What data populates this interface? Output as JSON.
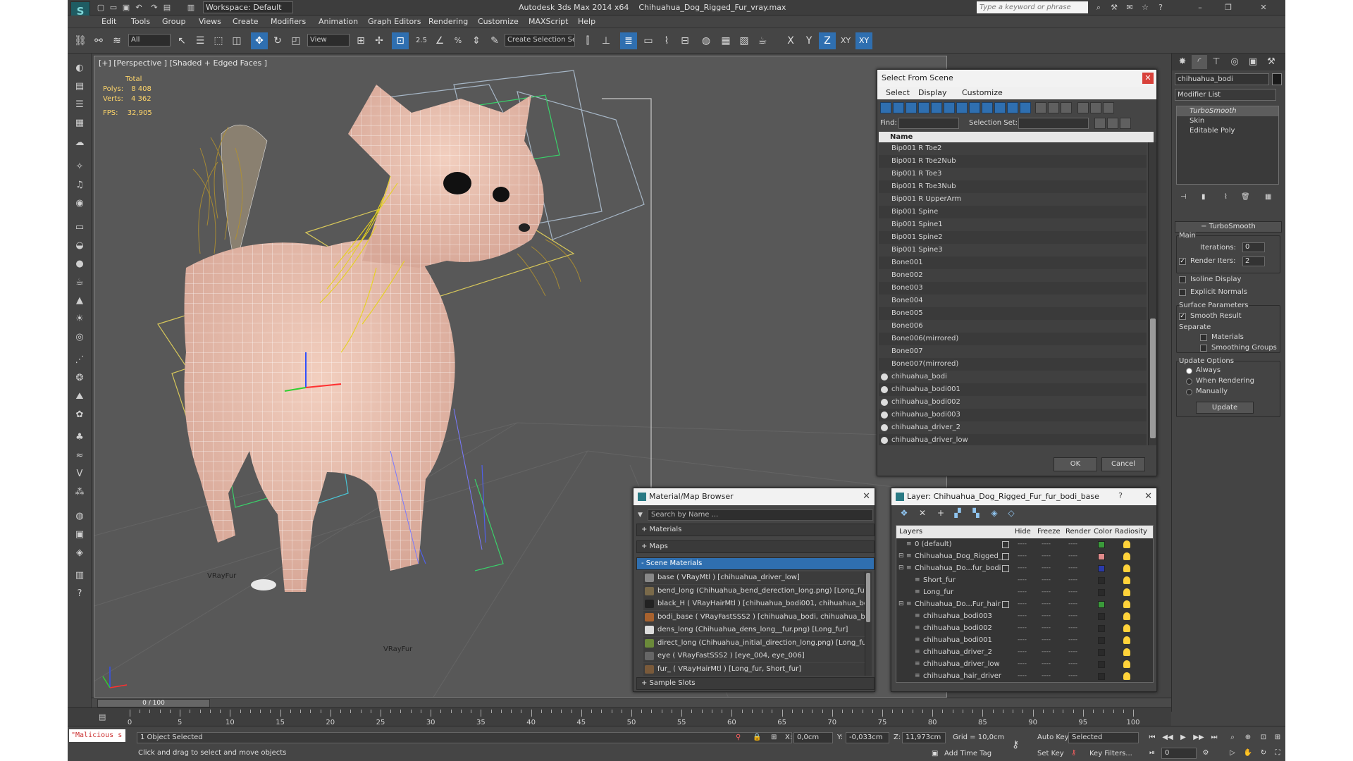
{
  "title": {
    "app": "Autodesk 3ds Max  2014 x64",
    "file": "Chihuahua_Dog_Rigged_Fur_vray.max",
    "workspace": "Workspace: Default",
    "search_placeholder": "Type a keyword or phrase"
  },
  "menu": [
    "Edit",
    "Tools",
    "Group",
    "Views",
    "Create",
    "Modifiers",
    "Animation",
    "Graph Editors",
    "Rendering",
    "Customize",
    "MAXScript",
    "Help"
  ],
  "toolbar": {
    "filter": "All",
    "ref_coord": "View",
    "snap_angle": "2.5",
    "selection_set": "Create Selection Se",
    "axis_x": "X",
    "axis_y": "Y",
    "axis_z": "Z",
    "axis_xy": "XY",
    "axis_xy2": "XY"
  },
  "viewport": {
    "label": "[+] [Perspective ] [Shaded + Edged Faces ]",
    "stats_total": "Total",
    "polys_label": "Polys:",
    "polys_value": "8 408",
    "verts_label": "Verts:",
    "verts_value": "4 362",
    "fps_label": "FPS:",
    "fps_value": "32,905",
    "vrayfur_1": "VRayFur",
    "vrayfur_2": "VRayFur"
  },
  "select_from_scene": {
    "title": "Select From Scene",
    "menu": [
      "Select",
      "Display",
      "Customize"
    ],
    "find_label": "Find:",
    "selection_set_label": "Selection Set:",
    "column_name": "Name",
    "rows": [
      "Bip001 R Toe2",
      "Bip001 R Toe2Nub",
      "Bip001 R Toe3",
      "Bip001 R Toe3Nub",
      "Bip001 R UpperArm",
      "Bip001 Spine",
      "Bip001 Spine1",
      "Bip001 Spine2",
      "Bip001 Spine3",
      "Bone001",
      "Bone002",
      "Bone003",
      "Bone004",
      "Bone005",
      "Bone006",
      "Bone006(mirrored)",
      "Bone007",
      "Bone007(mirrored)",
      "chihuahua_bodi",
      "chihuahua_bodi001",
      "chihuahua_bodi002",
      "chihuahua_bodi003",
      "chihuahua_driver_2",
      "chihuahua_driver_low"
    ],
    "ok": "OK",
    "cancel": "Cancel"
  },
  "material_browser": {
    "title": "Material/Map Browser",
    "search_placeholder": "Search by Name ...",
    "sections": [
      "+ Materials",
      "+ Maps",
      "- Scene Materials",
      "+ Sample Slots"
    ],
    "items": [
      {
        "label": "base  ( VRayMtl )  [chihuahua_driver_low]",
        "color": "#888888"
      },
      {
        "label": "bend_long (Chihuahua_bend_derection_long.png) [Long_fur]",
        "color": "#7a6a4a"
      },
      {
        "label": "black_H  ( VRayHairMtl )  [chihuahua_bodi001, chihuahua_bodi...",
        "color": "#222222"
      },
      {
        "label": "bodi_base  ( VRayFastSSS2 )  [chihuahua_bodi, chihuahua_bod...",
        "color": "#a8622e"
      },
      {
        "label": "dens_long (Chihuahua_dens_long__fur.png) [Long_fur]",
        "color": "#dddddd"
      },
      {
        "label": "direct_long (Chihuahua_initial_direction_long.png) [Long_fur]",
        "color": "#6b8a3a"
      },
      {
        "label": "eye  ( VRayFastSSS2 )  [eye_004, eye_006]",
        "color": "#666666"
      },
      {
        "label": "fur_  ( VRayHairMtl )  [Long_fur, Short_fur]",
        "color": "#7a5a3a"
      }
    ]
  },
  "layer_manager": {
    "title": "Layer: Chihuahua_Dog_Rigged_Fur_fur_bodi_base",
    "help": "?",
    "columns": [
      "Layers",
      "Hide",
      "Freeze",
      "Render",
      "Color",
      "Radiosity"
    ],
    "rows": [
      {
        "name": "0 (default)",
        "indent": 0,
        "color": "#3a9a3a"
      },
      {
        "name": "Chihuahua_Dog_Rigged_",
        "indent": 0,
        "color": "#e08a8a"
      },
      {
        "name": "Chihuahua_Do...fur_bodi",
        "indent": 0,
        "color": "#2a3aaa"
      },
      {
        "name": "Short_fur",
        "indent": 1,
        "color": "#2a2a2a"
      },
      {
        "name": "Long_fur",
        "indent": 1,
        "color": "#2a2a2a"
      },
      {
        "name": "Chihuahua_Do...Fur_hair",
        "indent": 0,
        "color": "#3a9a3a"
      },
      {
        "name": "chihuahua_bodi003",
        "indent": 1,
        "color": "#2a2a2a"
      },
      {
        "name": "chihuahua_bodi002",
        "indent": 1,
        "color": "#2a2a2a"
      },
      {
        "name": "chihuahua_bodi001",
        "indent": 1,
        "color": "#2a2a2a"
      },
      {
        "name": "chihuahua_driver_2",
        "indent": 1,
        "color": "#2a2a2a"
      },
      {
        "name": "chihuahua_driver_low",
        "indent": 1,
        "color": "#2a2a2a"
      },
      {
        "name": "chihuahua_hair_driver",
        "indent": 1,
        "color": "#2a2a2a"
      }
    ],
    "dash": "----"
  },
  "command_panel": {
    "object_name": "chihuahua_bodi",
    "modifier_list": "Modifier List",
    "stack": [
      "TurboSmooth",
      "Skin",
      "Editable Poly"
    ],
    "rollout_title": "TurboSmooth",
    "main_label": "Main",
    "iterations_label": "Iterations:",
    "iterations_value": "0",
    "render_iters_label": "Render Iters:",
    "render_iters_value": "2",
    "isoline_display": "Isoline Display",
    "explicit_normals": "Explicit Normals",
    "surface_parameters": "Surface Parameters",
    "smooth_result": "Smooth Result",
    "separate": "Separate",
    "materials": "Materials",
    "smoothing_groups": "Smoothing Groups",
    "update_options": "Update Options",
    "always": "Always",
    "when_rendering": "When Rendering",
    "manually": "Manually",
    "update_button": "Update"
  },
  "timeline": {
    "slider": "0 / 100",
    "ticks": [
      "0",
      "5",
      "10",
      "15",
      "20",
      "25",
      "30",
      "35",
      "40",
      "45",
      "50",
      "55",
      "60",
      "65",
      "70",
      "75",
      "80",
      "85",
      "90",
      "95",
      "100"
    ]
  },
  "status": {
    "maxscript": "\"Malicious s",
    "selected": "1 Object Selected",
    "prompt": "Click and drag to select and move objects",
    "x_label": "X:",
    "x_value": "0,0cm",
    "y_label": "Y:",
    "y_value": "-0,033cm",
    "z_label": "Z:",
    "z_value": "11,973cm",
    "grid": "Grid = 10,0cm",
    "add_time_tag": "Add Time Tag",
    "auto_key": "Auto Key",
    "set_key": "Set Key",
    "selected_drop": "Selected",
    "key_filters": "Key Filters...",
    "frame": "0"
  }
}
